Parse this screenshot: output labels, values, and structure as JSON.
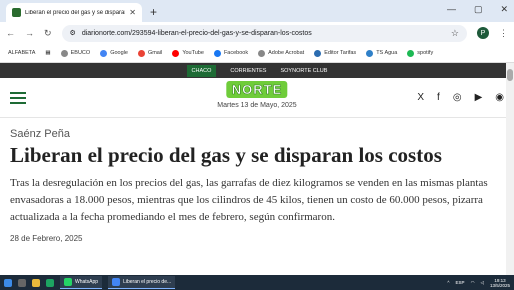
{
  "browser": {
    "tab_title": "Liberan el precio del gas y se disparan los co",
    "new_tab": "+",
    "url": "diarionorte.com/293594-liberan-el-precio-del-gas-y-se-disparan-los-costos",
    "profile_initial": "P",
    "bookmarks": [
      "ALFABETA",
      "EBUCO",
      "Google",
      "Gmail",
      "YouTube",
      "Facebook",
      "Adobe Acrobat",
      "Editor Tarifas",
      "TS Agua",
      "spotify"
    ]
  },
  "site": {
    "nav": [
      "CHACO",
      "CORRIENTES",
      "SOYNORTE CLUB"
    ],
    "logo": "NORTE",
    "date": "Martes  13 de Mayo, 2025",
    "social": [
      "X",
      "f",
      "◎",
      "▶",
      "◉"
    ]
  },
  "article": {
    "kicker": "Saénz Peña",
    "headline": "Liberan el precio del gas y se disparan los costos",
    "lead": "Tras la desregulación en los precios del gas, las garrafas de diez kilogramos se venden en las mismas plantas envasadoras a 18.000 pesos, mientras que los cilindros de 45 kilos, tienen un costo de 60.000 pesos, pizarra actualizada a la fecha promediando el mes de febrero, según confirmaron.",
    "published": "28 de Febrero, 2025"
  },
  "taskbar": {
    "apps": [
      "WhatsApp",
      "Liberan el precio de..."
    ],
    "lang": "ESP",
    "time": "19:13",
    "date": "13/5/2025"
  },
  "colors": {
    "brand_green": "#1e6b35",
    "logo_green": "#6fcc3a"
  }
}
